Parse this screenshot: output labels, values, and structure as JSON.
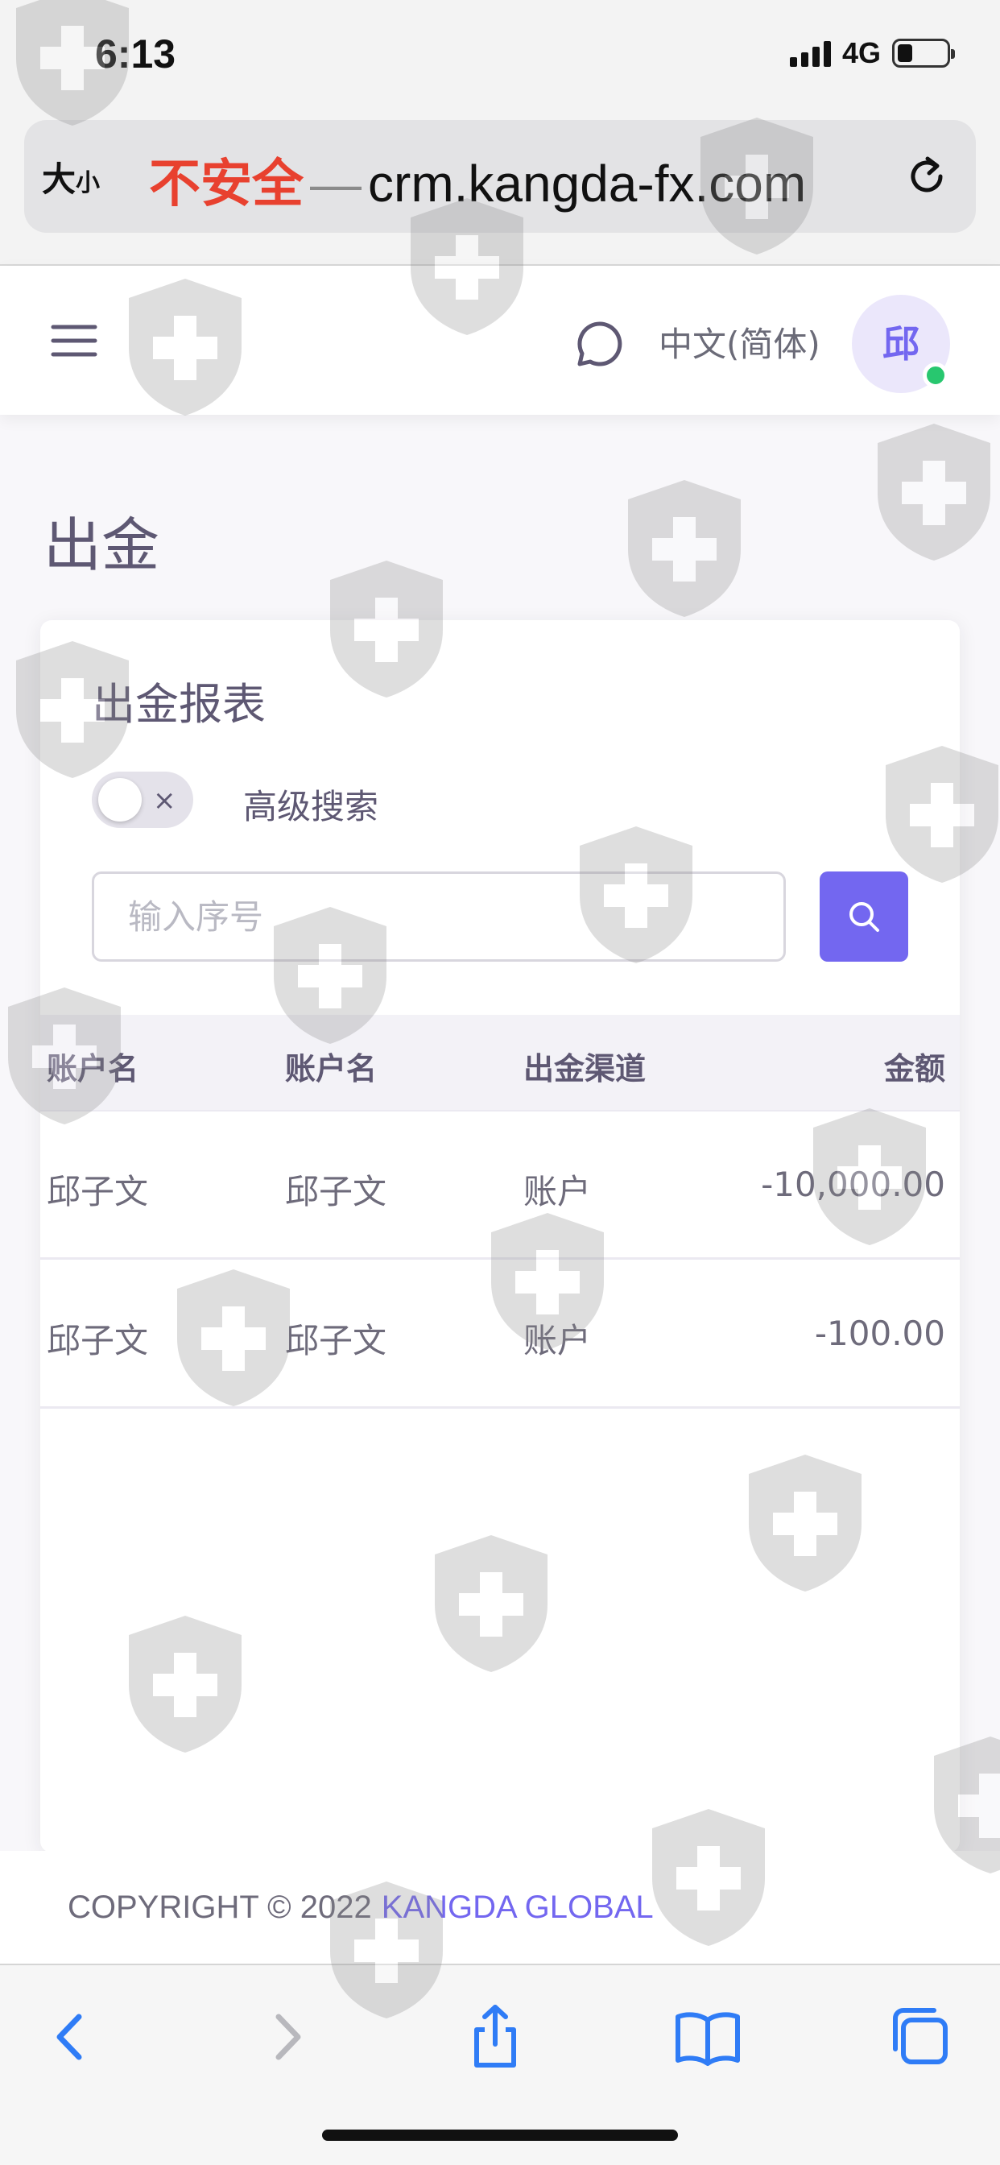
{
  "status_bar": {
    "time": "6:13",
    "network": "4G"
  },
  "browser": {
    "text_size_button": "大",
    "text_size_small": "小",
    "security_label": "不安全",
    "separator": "—",
    "domain": "crm.kangda-fx.com"
  },
  "header": {
    "language": "中文(简体)",
    "avatar_initial": "邱"
  },
  "page": {
    "title": "出金",
    "card_title": "出金报表",
    "advanced_search_label": "高级搜索",
    "toggle_symbol": "×",
    "search_placeholder": "输入序号"
  },
  "table": {
    "columns": [
      "账户名",
      "账户名",
      "出金渠道",
      "金额"
    ],
    "rows": [
      [
        "邱子文",
        "邱子文",
        "账户",
        "-10,000.00"
      ],
      [
        "邱子文",
        "邱子文",
        "账户",
        "-100.00"
      ]
    ]
  },
  "footer": {
    "copyright": "COPYRIGHT © 2022",
    "brand": "KANGDA GLOBAL"
  },
  "colors": {
    "primary": "#7367f0",
    "online": "#28c76f",
    "not_secure": "#e8412f"
  }
}
